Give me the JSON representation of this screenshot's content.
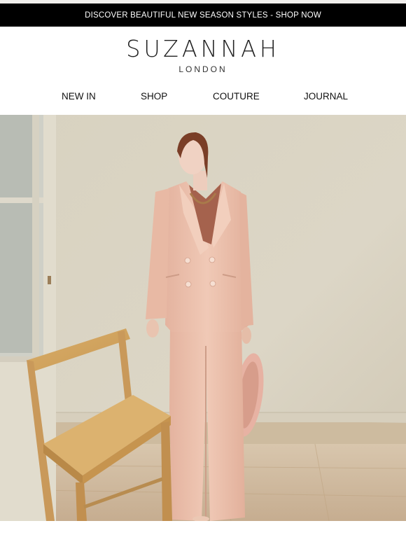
{
  "promo": {
    "text": "DISCOVER BEAUTIFUL NEW SEASON STYLES - SHOP NOW"
  },
  "brand": {
    "name": "SUZANNAH",
    "location": "LONDON"
  },
  "nav": {
    "items": [
      "NEW IN",
      "SHOP",
      "COUTURE",
      "JOURNAL"
    ]
  },
  "colors": {
    "promo_bg": "#000000",
    "wall": "#dad4c2",
    "suit": "#ecc1ac",
    "chair": "#d2a460",
    "floor": "#cdb69b"
  }
}
